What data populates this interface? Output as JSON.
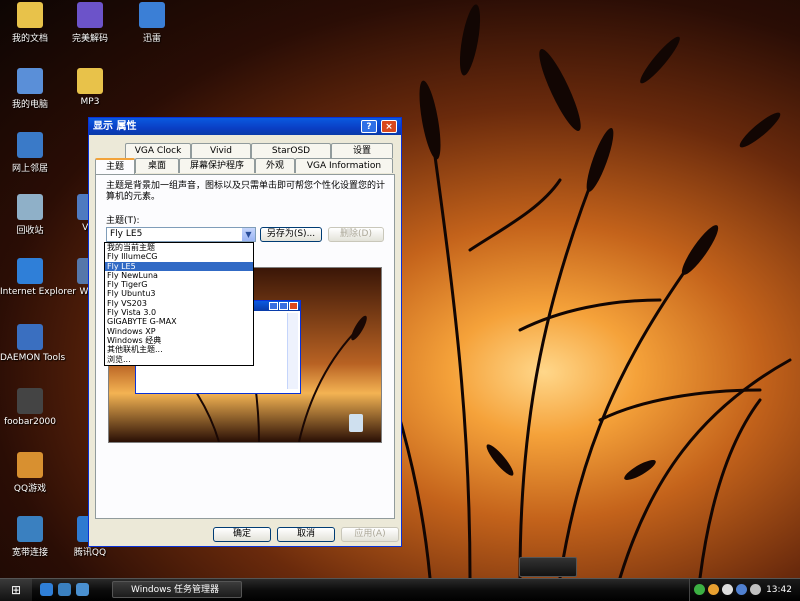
{
  "desktop": {
    "icons": [
      {
        "label": "我的文档",
        "color": "#e8c24a"
      },
      {
        "label": "完美解码",
        "color": "#6c53c9"
      },
      {
        "label": "迅雷",
        "color": "#3b7fd6"
      },
      {
        "label": "我的电脑",
        "color": "#5a8fd8"
      },
      {
        "label": "MP3",
        "color": "#e8c24a"
      },
      {
        "label": "网上邻居",
        "color": "#3a7ac8"
      },
      {
        "label": "回收站",
        "color": "#8fb0c8"
      },
      {
        "label": "Virt",
        "color": "#4f7ac0"
      },
      {
        "label": "Internet Explorer",
        "color": "#2f7fd8"
      },
      {
        "label": "WINI",
        "color": "#5577aa"
      },
      {
        "label": "DAEMON Tools",
        "color": "#3a6fc0"
      },
      {
        "label": "foobar2000",
        "color": "#444444"
      },
      {
        "label": "QQ游戏",
        "color": "#d89030"
      },
      {
        "label": "宽带连接",
        "color": "#3a80c0"
      },
      {
        "label": "腾讯QQ",
        "color": "#2e7ad0"
      }
    ]
  },
  "dialog": {
    "title": "显示 属性",
    "help_label": "?",
    "close_label": "×",
    "tabs_top": [
      "VGA Clock",
      "Vivid",
      "StarOSD",
      "设置"
    ],
    "tabs_bottom": [
      "主题",
      "桌面",
      "屏幕保护程序",
      "外观",
      "VGA Information"
    ],
    "description": "主题是背景加一组声音，图标以及只需单击即可帮您个性化设置您的计算机的元素。",
    "theme_label": "主题(T):",
    "theme_value": "Fly LE5",
    "save_as_label": "另存为(S)...",
    "delete_label": "删除(D)",
    "theme_options": [
      "我的当前主题",
      "Fly IllumeCG",
      "Fly LE5",
      "Fly NewLuna",
      "Fly TigerG",
      "Fly Ubuntu3",
      "Fly VS203",
      "Fly Vista 3.0",
      "GIGABYTE G-MAX",
      "Windows XP",
      "Windows 经典",
      "其他联机主题...",
      "浏览..."
    ],
    "selected_option_index": 2,
    "ok_label": "确定",
    "cancel_label": "取消",
    "apply_label": "应用(A)"
  },
  "taskbar": {
    "start_label": "⊞",
    "task_label": "Windows 任务管理器",
    "clock": "13:42"
  }
}
